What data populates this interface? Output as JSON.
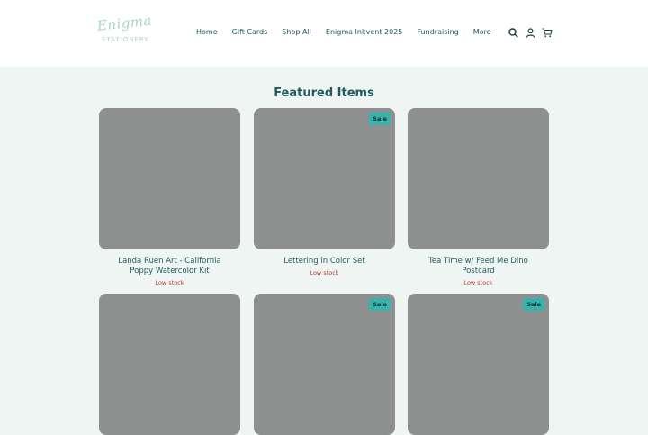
{
  "header": {
    "logo": {
      "script_text": "Enigma",
      "sub_text": "STATIONERY"
    },
    "nav": [
      {
        "label": "Home"
      },
      {
        "label": "Gift Cards"
      },
      {
        "label": "Shop All"
      },
      {
        "label": "Enigma Inkvent 2025"
      },
      {
        "label": "Fundraising"
      },
      {
        "label": "More"
      }
    ],
    "icons": [
      "search-icon",
      "account-icon",
      "cart-icon"
    ]
  },
  "featured": {
    "title": "Featured Items",
    "items": [
      {
        "title": "Landa Ruen Art - California Poppy Watercolor Kit",
        "stock": "Low stock",
        "badge": ""
      },
      {
        "title": "Lettering in Color Set",
        "stock": "Low stock",
        "badge": "Sale"
      },
      {
        "title": "Tea Time w/ Feed Me Dino Postcard",
        "stock": "Low stock",
        "badge": ""
      },
      {
        "title": "",
        "stock": "",
        "badge": ""
      },
      {
        "title": "",
        "stock": "",
        "badge": "Sale"
      },
      {
        "title": "",
        "stock": "",
        "badge": "Sale"
      }
    ]
  },
  "colors": {
    "brand_teal": "#1f5a5e",
    "sale_badge": "#38b2ac",
    "low_stock": "#c0392b",
    "page_bg": "#eef5f2",
    "image_placeholder": "#8d908f"
  }
}
